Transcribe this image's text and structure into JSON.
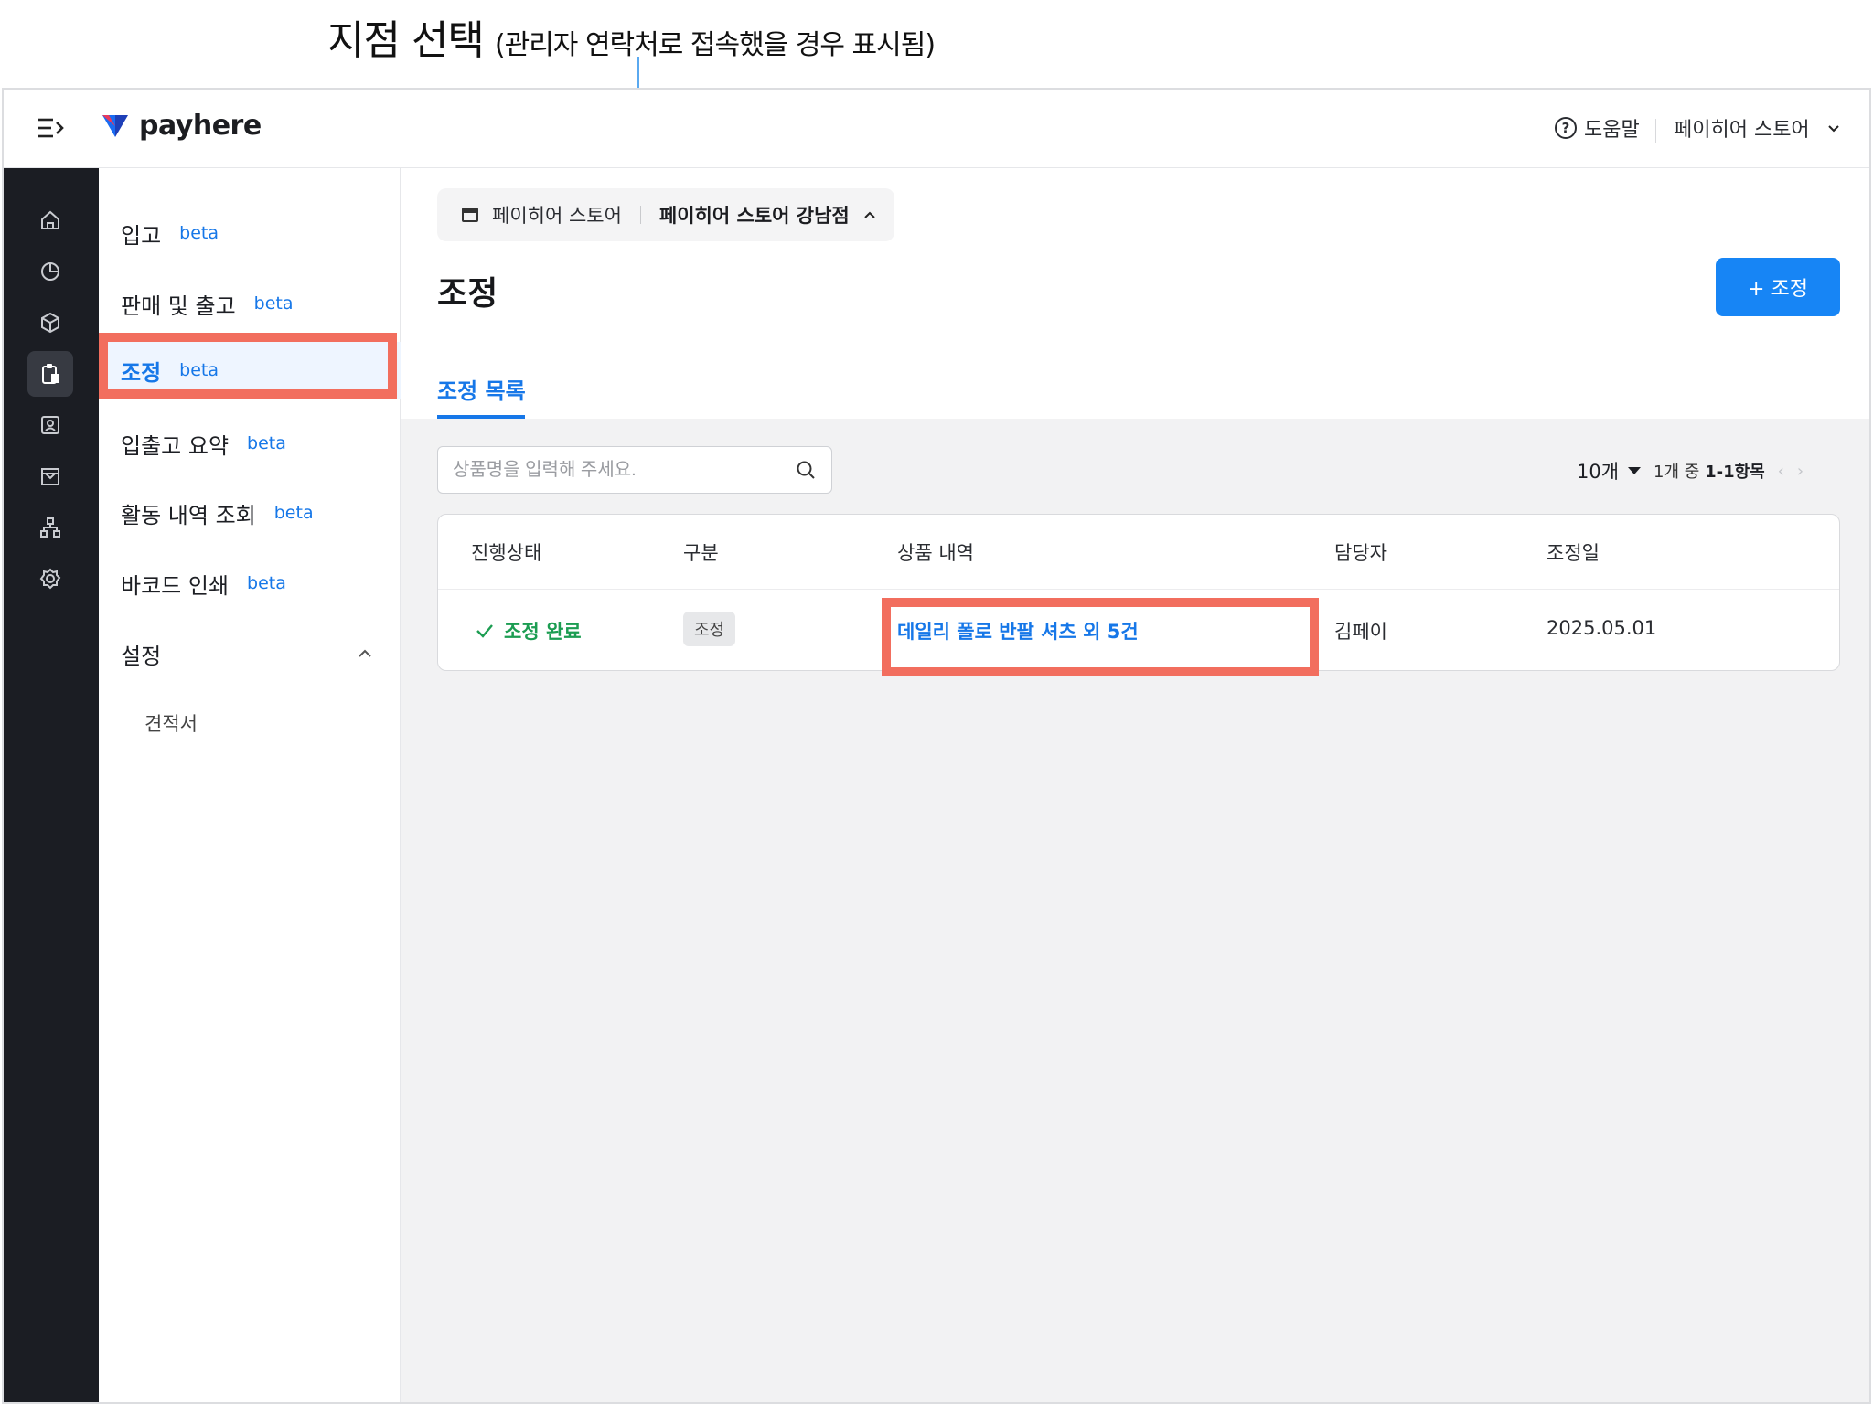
{
  "annotation": {
    "title": "지점 선택",
    "subtitle": "(관리자 연락처로 접속했을 경우 표시됨)"
  },
  "topbar": {
    "logo_text": "payhere",
    "help_label": "도움말",
    "store_label": "페이히어 스토어"
  },
  "rail": {
    "icons": [
      "home-icon",
      "chart-icon",
      "box-icon",
      "clipboard-icon",
      "contact-icon",
      "store-icon",
      "org-icon",
      "gear-icon"
    ],
    "active_index": 3
  },
  "subnav": {
    "items": [
      {
        "label": "입고",
        "badge": "beta"
      },
      {
        "label": "판매 및 출고",
        "badge": "beta"
      },
      {
        "label": "조정",
        "badge": "beta",
        "active": true
      },
      {
        "label": "입출고 요약",
        "badge": "beta"
      },
      {
        "label": "활동 내역 조회",
        "badge": "beta"
      },
      {
        "label": "바코드 인쇄",
        "badge": "beta"
      }
    ],
    "settings": {
      "label": "설정",
      "sub_items": [
        "견적서"
      ]
    }
  },
  "main": {
    "breadcrumb": {
      "store": "페이히어 스토어",
      "branch": "페이히어 스토어 강남점"
    },
    "title": "조정",
    "add_button": "+ 조정",
    "tab": "조정 목록",
    "search_placeholder": "상품명을 입력해 주세요.",
    "pagination": {
      "page_size": "10개",
      "range_prefix": "1개 중",
      "range": "1-1항목"
    },
    "table": {
      "headers": [
        "진행상태",
        "구분",
        "상품 내역",
        "담당자",
        "조정일"
      ],
      "rows": [
        {
          "status": "조정 완료",
          "type": "조정",
          "product": "데일리 폴로 반팔 셔츠 외 5건",
          "manager": "김페이",
          "date": "2025.05.01"
        }
      ]
    }
  },
  "colors": {
    "accent": "#1785f5",
    "highlight": "#f26e5e",
    "success": "#1c9d52",
    "rail_bg": "#1b1d23"
  }
}
